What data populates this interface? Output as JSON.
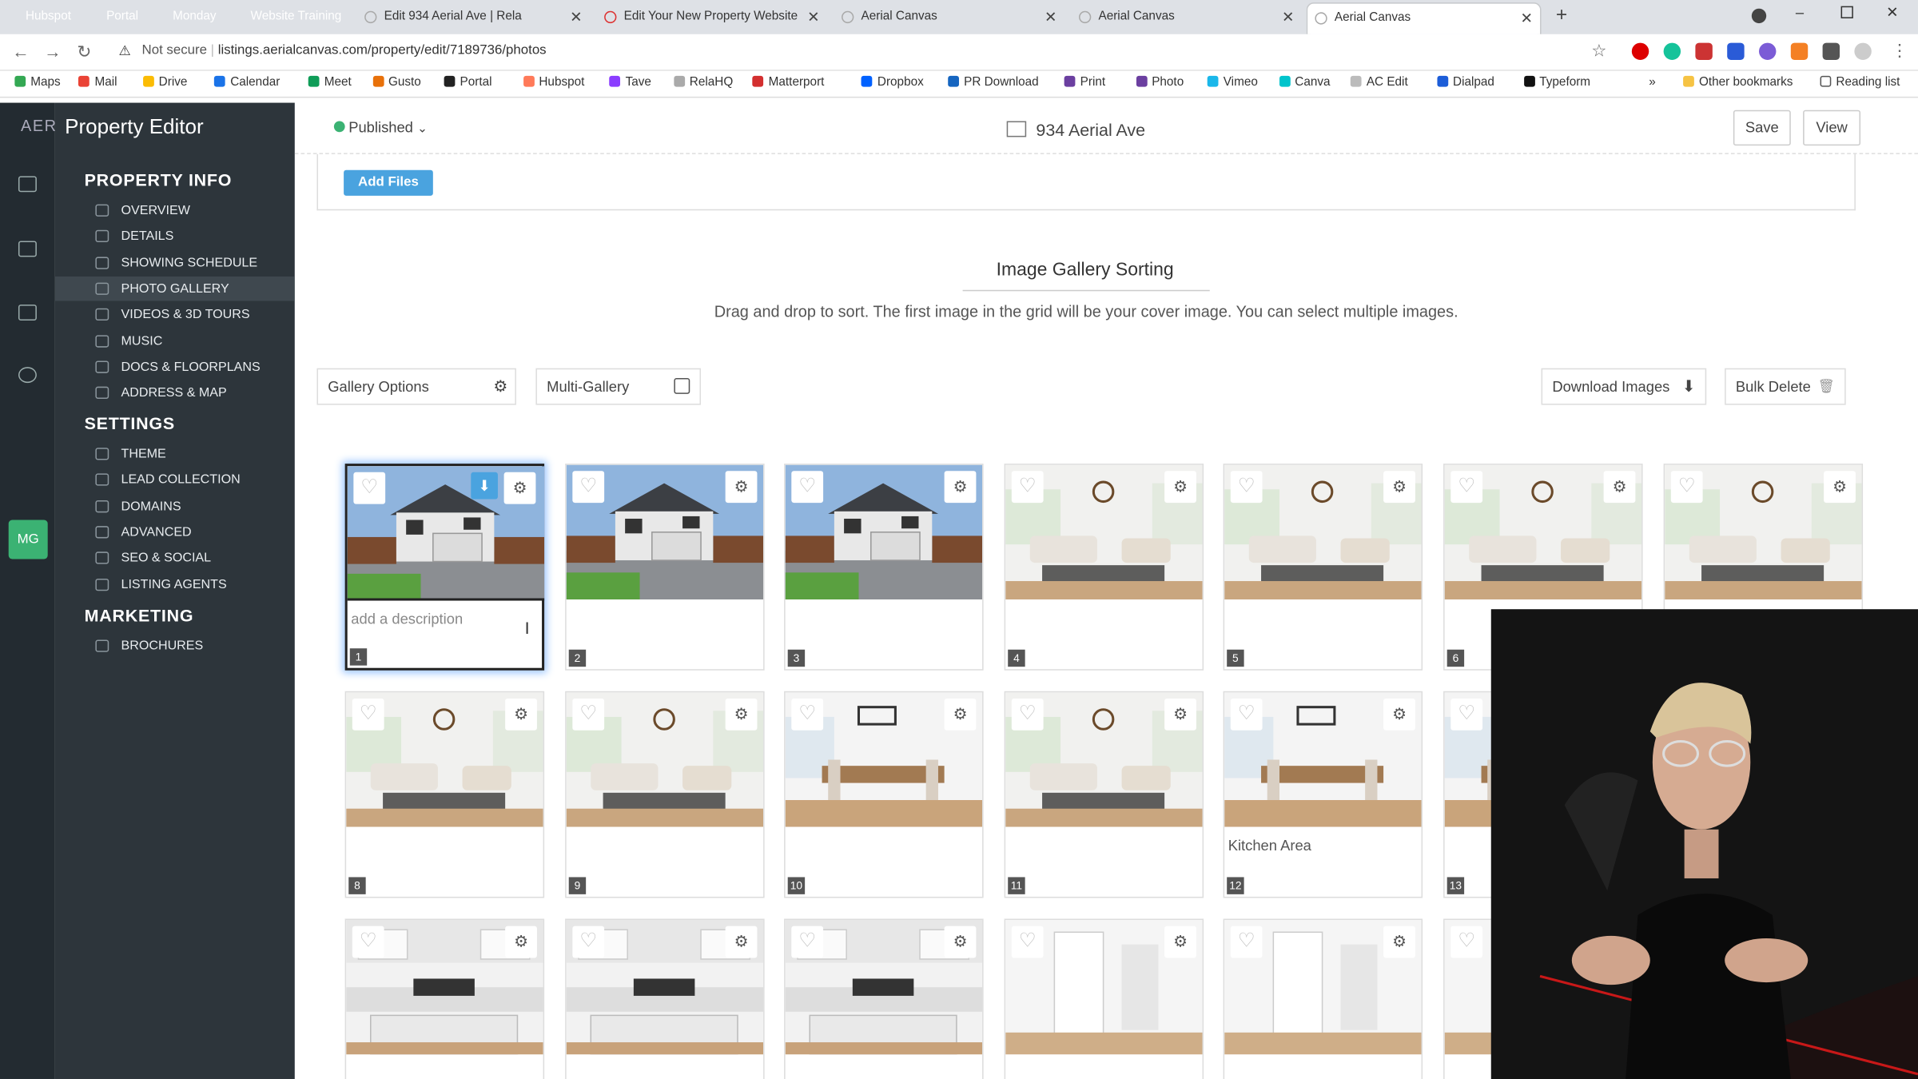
{
  "browser": {
    "tab_groups": [
      {
        "label": "Hubspot",
        "color": "#e8710a"
      },
      {
        "label": "Portal",
        "color": "#5f6368"
      },
      {
        "label": "Monday",
        "color": "#d01884"
      },
      {
        "label": "Website Training",
        "color": "#12857b"
      }
    ],
    "tabs": [
      {
        "title": "Edit 934 Aerial Ave | Rela",
        "active": false
      },
      {
        "title": "Edit Your New Property Website",
        "active": false
      },
      {
        "title": "Aerial Canvas",
        "active": false
      },
      {
        "title": "Aerial Canvas",
        "active": false
      },
      {
        "title": "Aerial Canvas",
        "active": true
      }
    ],
    "new_tab": "+",
    "security": "Not secure",
    "url": "listings.aerialcanvas.com/property/edit/7189736/photos",
    "bookmarks": [
      "Maps",
      "Mail",
      "Drive",
      "Calendar",
      "Meet",
      "Gusto",
      "Portal",
      "Hubspot",
      "Tave",
      "RelaHQ",
      "Matterport",
      "Dropbox",
      "PR Download",
      "Print",
      "Photo",
      "Vimeo",
      "Canva",
      "AC Edit",
      "Dialpad",
      "Typeform"
    ],
    "other_bookmarks": "Other bookmarks",
    "reading_list": "Reading list",
    "overflow": "»"
  },
  "rail": {
    "logo": "AER",
    "avatar": "MG"
  },
  "sidebar": {
    "title": "Property Editor",
    "sections": [
      {
        "heading": "PROPERTY INFO",
        "items": [
          "OVERVIEW",
          "DETAILS",
          "SHOWING SCHEDULE",
          "PHOTO GALLERY",
          "VIDEOS & 3D TOURS",
          "MUSIC",
          "DOCS & FLOORPLANS",
          "ADDRESS & MAP"
        ]
      },
      {
        "heading": "SETTINGS",
        "items": [
          "THEME",
          "LEAD COLLECTION",
          "DOMAINS",
          "ADVANCED",
          "SEO & SOCIAL",
          "LISTING AGENTS"
        ]
      },
      {
        "heading": "MARKETING",
        "items": [
          "BROCHURES"
        ]
      }
    ],
    "selected": "PHOTO GALLERY"
  },
  "header": {
    "status": "Published",
    "property": "934 Aerial Ave",
    "save": "Save",
    "view": "View"
  },
  "upload": {
    "add_files": "Add Files"
  },
  "gallery": {
    "title": "Image Gallery Sorting",
    "description": "Drag and drop to sort. The first image in the grid will be your cover image. You can select multiple images.",
    "gallery_options": "Gallery Options",
    "multi_gallery": "Multi-Gallery",
    "download_images": "Download Images",
    "bulk_delete": "Bulk Delete",
    "placeholder": "add a description",
    "images": [
      {
        "n": "1",
        "desc": "",
        "scene": "exterior"
      },
      {
        "n": "2",
        "desc": "",
        "scene": "exterior"
      },
      {
        "n": "3",
        "desc": "",
        "scene": "exterior"
      },
      {
        "n": "4",
        "desc": "",
        "scene": "living"
      },
      {
        "n": "5",
        "desc": "",
        "scene": "living"
      },
      {
        "n": "6",
        "desc": "",
        "scene": "living"
      },
      {
        "n": "",
        "desc": "",
        "scene": "living"
      },
      {
        "n": "8",
        "desc": "",
        "scene": "living"
      },
      {
        "n": "9",
        "desc": "",
        "scene": "living"
      },
      {
        "n": "10",
        "desc": "",
        "scene": "dining"
      },
      {
        "n": "11",
        "desc": "",
        "scene": "living"
      },
      {
        "n": "12",
        "desc": "Kitchen Area",
        "scene": "dining"
      },
      {
        "n": "13",
        "desc": "",
        "scene": "dining"
      },
      {
        "n": "",
        "desc": "",
        "scene": "kitchen"
      },
      {
        "n": "",
        "desc": "",
        "scene": "kitchen"
      },
      {
        "n": "",
        "desc": "",
        "scene": "kitchen"
      },
      {
        "n": "",
        "desc": "",
        "scene": "hall"
      },
      {
        "n": "",
        "desc": "",
        "scene": "hall"
      },
      {
        "n": "",
        "desc": "",
        "scene": "hall"
      }
    ]
  },
  "colors": {
    "accent": "#4aa3df",
    "sidebar": "#2d353b",
    "rail": "#232b31",
    "published": "#3bb273"
  }
}
